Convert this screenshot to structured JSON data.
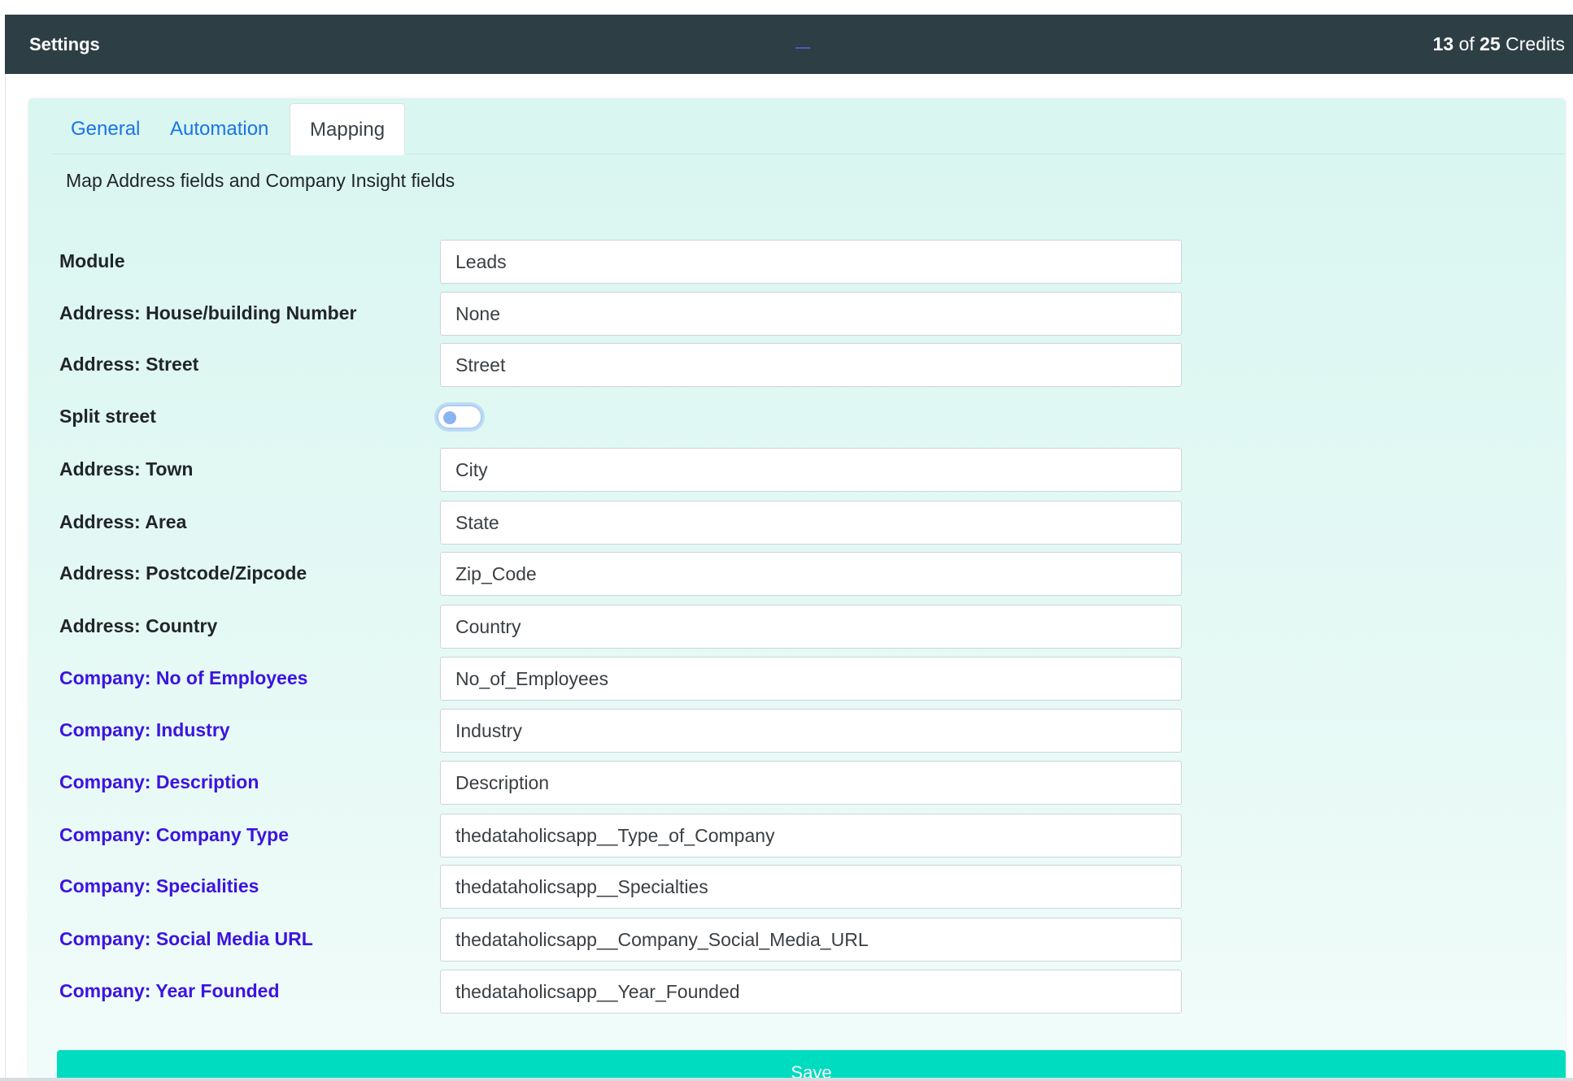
{
  "header": {
    "title": "Settings",
    "credits_used": "13",
    "credits_of": "of",
    "credits_total": "25",
    "credits_label": "Credits"
  },
  "tabs": [
    {
      "label": "General",
      "active": false
    },
    {
      "label": "Automation",
      "active": false
    },
    {
      "label": "Mapping",
      "active": true
    }
  ],
  "subtitle": "Map Address fields and Company Insight fields",
  "rows": [
    {
      "label": "Module",
      "value": "Leads",
      "type": "select"
    },
    {
      "label": "Address: House/building Number",
      "value": "None",
      "type": "select"
    },
    {
      "label": "Address: Street",
      "value": "Street",
      "type": "select"
    },
    {
      "label": "Split street",
      "value": "",
      "type": "toggle",
      "checked": false
    },
    {
      "label": "Address: Town",
      "value": "City",
      "type": "select"
    },
    {
      "label": "Address: Area",
      "value": "State",
      "type": "select"
    },
    {
      "label": "Address: Postcode/Zipcode",
      "value": "Zip_Code",
      "type": "select"
    },
    {
      "label": "Address: Country",
      "value": "Country",
      "type": "select"
    },
    {
      "label": "Company: No of Employees",
      "value": "No_of_Employees",
      "type": "select"
    },
    {
      "label": "Company: Industry",
      "value": "Industry",
      "type": "select"
    },
    {
      "label": "Company: Description",
      "value": "Description",
      "type": "select"
    },
    {
      "label": "Company: Company Type",
      "value": "thedataholicsapp__Type_of_Company",
      "type": "select"
    },
    {
      "label": "Company: Specialities",
      "value": "thedataholicsapp__Specialties",
      "type": "select"
    },
    {
      "label": "Company: Social Media URL",
      "value": "thedataholicsapp__Company_Social_Media_URL",
      "type": "select"
    },
    {
      "label": "Company: Year Founded",
      "value": "thedataholicsapp__Year_Founded",
      "type": "select"
    }
  ],
  "save_label": "Save",
  "colors": {
    "header_bg": "#2e3e45",
    "company_label": "#3b14e0",
    "tab_link": "#1a73e8",
    "save_button": "#00dcc0",
    "card_bg": "#d9f6f0"
  }
}
